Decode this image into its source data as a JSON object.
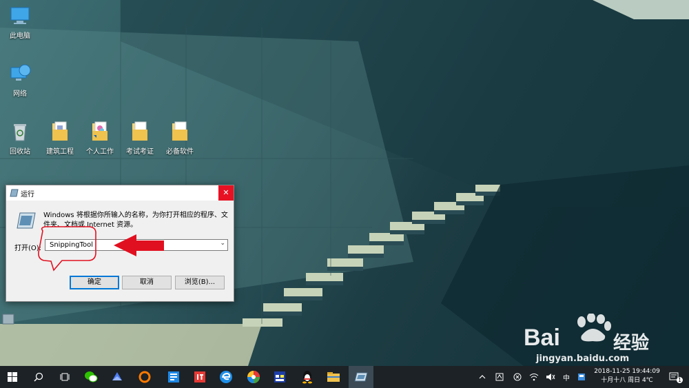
{
  "desktop": {
    "icons": [
      {
        "label": "此电脑",
        "icon": "computer-icon"
      },
      {
        "label": "网络",
        "icon": "network-icon"
      },
      {
        "label": "回收站",
        "icon": "recycle-bin-icon"
      },
      {
        "label": "建筑工程",
        "icon": "folder-icon"
      },
      {
        "label": "个人工作",
        "icon": "folder-icon"
      },
      {
        "label": "考试考证",
        "icon": "folder-icon"
      },
      {
        "label": "必备软件",
        "icon": "folder-icon"
      }
    ]
  },
  "run_dialog": {
    "title": "运行",
    "close_glyph": "✕",
    "description": "Windows 将根据你所输入的名称，为你打开相应的程序、文件夹、文档或 Internet 资源。",
    "open_label": "打开(O):",
    "command_value": "SnippingTool",
    "dropdown_glyph": "⌄",
    "buttons": {
      "ok": "确定",
      "cancel": "取消",
      "browse": "浏览(B)..."
    }
  },
  "taskbar": {
    "apps": [
      "start-icon",
      "search-icon",
      "task-view-icon",
      "wechat-icon",
      "feishu-icon",
      "uc-browser-icon",
      "news-icon",
      "it-app-icon",
      "edge-icon",
      "photo-app-icon",
      "calendar-app-icon",
      "qq-icon",
      "file-explorer-icon",
      "run-icon"
    ],
    "tray": {
      "ime": "中",
      "time": "19:44:09",
      "date": "2018-11-25",
      "lunar": "十月十八 周日 4℃",
      "notifications": "1"
    }
  },
  "watermark": {
    "brand_text": "Bai",
    "brand_cn": "经验",
    "url": "jingyan.baidu.com"
  },
  "colors": {
    "accent": "#e81123",
    "annotation_red": "#e11020",
    "taskbar_bg": "#1c2226"
  }
}
